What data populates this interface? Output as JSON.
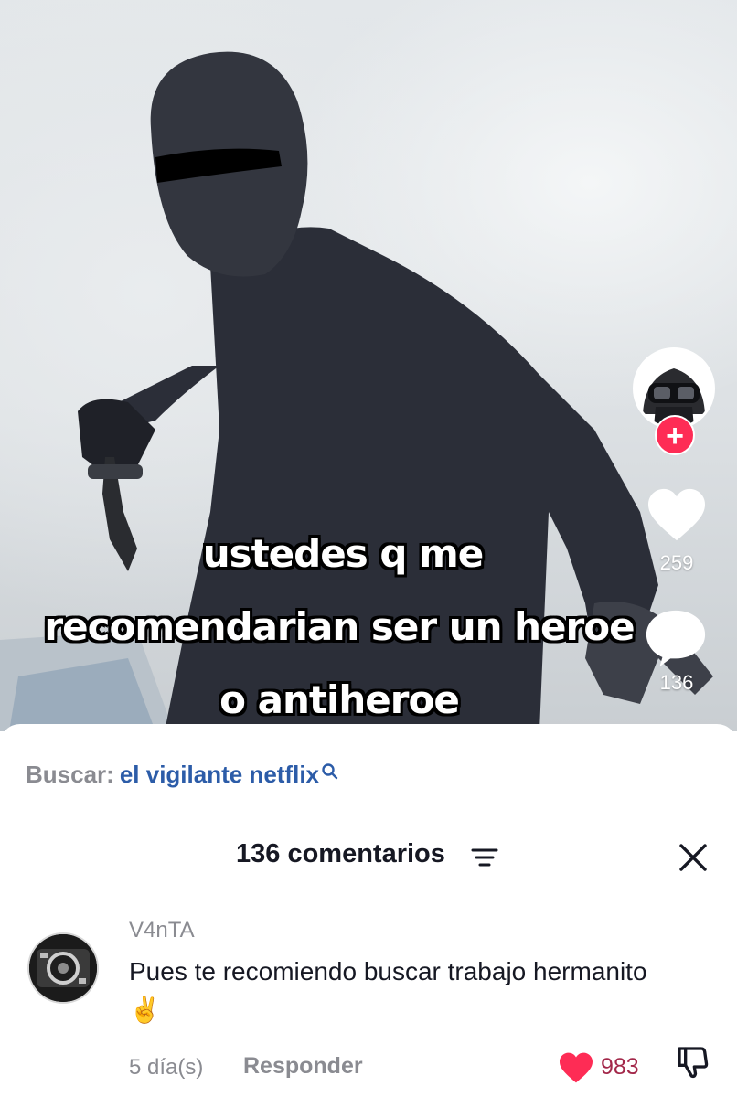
{
  "video": {
    "caption_lines": [
      "ustedes q me",
      "recomendarian ser un heroe",
      "o antiheroe"
    ],
    "likes": "259",
    "comments": "136",
    "follow_symbol": "+"
  },
  "search": {
    "prefix": "Buscar:",
    "query": "el vigilante netflix"
  },
  "comments_panel": {
    "title": "136 comentarios",
    "comment": {
      "username": "V4nTA",
      "text": "Pues te recomiendo buscar trabajo hermanito ✌️",
      "time": "5 día(s)",
      "reply_label": "Responder",
      "likes": "983"
    }
  },
  "colors": {
    "accent": "#fe2c55",
    "search_link": "#2c5ca8",
    "like_count": "#a3284a"
  },
  "icons": [
    "plus-icon",
    "heart-icon",
    "comment-bubble-icon",
    "search-icon",
    "filter-icon",
    "close-icon",
    "dislike-icon"
  ]
}
